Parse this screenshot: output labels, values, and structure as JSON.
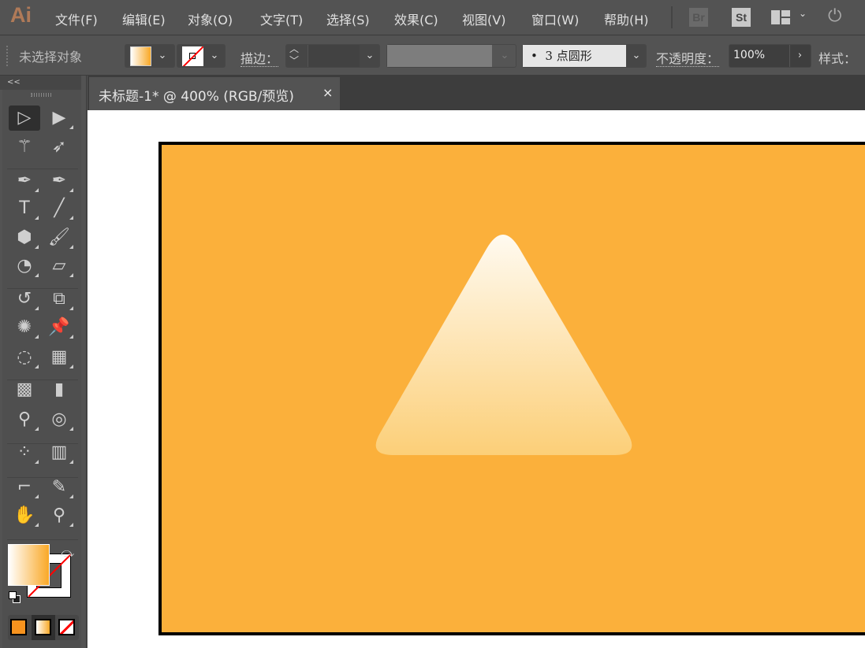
{
  "app": {
    "logo": "Ai"
  },
  "menu": [
    "文件(F)",
    "编辑(E)",
    "对象(O)",
    "文字(T)",
    "选择(S)",
    "效果(C)",
    "视图(V)",
    "窗口(W)",
    "帮助(H)"
  ],
  "app_buttons": {
    "bridge": "Br",
    "stock": "St"
  },
  "control": {
    "selection": "未选择对象",
    "stroke_label": "描边：",
    "brush": "3 点圆形",
    "opacity_label": "不透明度：",
    "opacity": "100%",
    "style_label": "样式："
  },
  "panel": {
    "collapse": "<<"
  },
  "tab": {
    "title": "未标题-1* @ 400% (RGB/预览)",
    "close": "×"
  },
  "tools": [
    [
      "selection-tool",
      "▷",
      "direct-selection-tool",
      "▶"
    ],
    [
      "magic-wand-tool",
      "⚚",
      "lasso-tool",
      "➶"
    ],
    [
      "pen-tool",
      "✒",
      "curvature-tool",
      "✒"
    ],
    [
      "type-tool",
      "T",
      "line-tool",
      "╱"
    ],
    [
      "polygon-tool",
      "⬢",
      "paintbrush-tool",
      "🖌"
    ],
    [
      "shaper-tool",
      "◔",
      "eraser-tool",
      "▱"
    ],
    [
      "rotate-tool",
      "↺",
      "scale-tool",
      "⧉"
    ],
    [
      "puppet-warp-tool",
      "✺",
      "pin-tool",
      "📌"
    ],
    [
      "free-transform-tool",
      "◌",
      "perspective-grid-tool",
      "▦"
    ],
    [
      "mesh-tool",
      "▩",
      "gradient-tool",
      "▮"
    ],
    [
      "eyedropper-tool",
      "⚲",
      "blend-tool",
      "◎"
    ],
    [
      "symbol-sprayer-tool",
      "⁘",
      "column-graph-tool",
      "▥"
    ],
    [
      "artboard-tool",
      "⌐",
      "slice-tool",
      "✎"
    ],
    [
      "hand-tool",
      "✋",
      "zoom-tool",
      "⚲"
    ]
  ],
  "colors": {
    "artboard": "#fbb03b",
    "fill_grad_start": "#ffffff",
    "fill_grad_end": "#f9a826",
    "mode_color": "#f7931e",
    "stroke_none": "#ff0000"
  }
}
